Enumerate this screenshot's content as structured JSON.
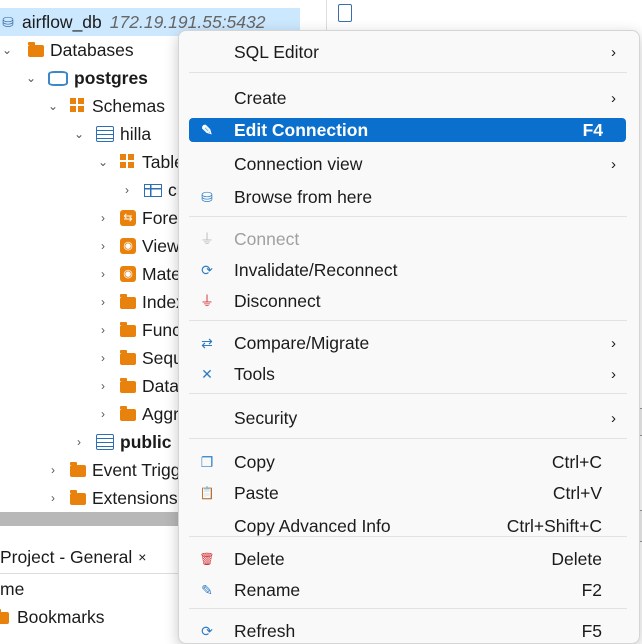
{
  "tree": {
    "connection": {
      "name": "airflow_db",
      "address": "172.19.191.55:5432"
    },
    "rows": [
      {
        "label": "Databases",
        "bold": false
      },
      {
        "label": "postgres",
        "bold": true
      },
      {
        "label": "Schemas",
        "bold": false
      },
      {
        "label": "hilla",
        "bold": false
      },
      {
        "label": "Table",
        "bold": false
      },
      {
        "label": "cr",
        "bold": false
      },
      {
        "label": "Forei",
        "bold": false
      },
      {
        "label": "View",
        "bold": false
      },
      {
        "label": "Mate",
        "bold": false
      },
      {
        "label": "Index",
        "bold": false
      },
      {
        "label": "Func",
        "bold": false
      },
      {
        "label": "Sequ",
        "bold": false
      },
      {
        "label": "Data",
        "bold": false
      },
      {
        "label": "Aggre",
        "bold": false
      },
      {
        "label": "public",
        "bold": true
      },
      {
        "label": "Event Trigg",
        "bold": false
      },
      {
        "label": "Extensions",
        "bold": false
      }
    ]
  },
  "bottom_panel": {
    "tab_label": "Project - General",
    "tab_close": "×",
    "column_header": "me",
    "bookmarks_label": "Bookmarks"
  },
  "context_menu": {
    "items": [
      {
        "label": "SQL Editor",
        "shortcut": "",
        "submenu": true,
        "icon": ""
      },
      {
        "label": "Create",
        "shortcut": "",
        "submenu": true,
        "icon": ""
      },
      {
        "label": "Edit Connection",
        "shortcut": "F4",
        "submenu": false,
        "icon": "pencil-icon",
        "glyph": "✎"
      },
      {
        "label": "Connection view",
        "shortcut": "",
        "submenu": true,
        "icon": ""
      },
      {
        "label": "Browse from here",
        "shortcut": "",
        "submenu": false,
        "icon": "database-browse-icon",
        "glyph": "⛁"
      },
      {
        "label": "Connect",
        "shortcut": "",
        "submenu": false,
        "icon": "plug-icon",
        "glyph": "⏚",
        "disabled": true
      },
      {
        "label": "Invalidate/Reconnect",
        "shortcut": "",
        "submenu": false,
        "icon": "reconnect-icon",
        "glyph": "⟳"
      },
      {
        "label": "Disconnect",
        "shortcut": "",
        "submenu": false,
        "icon": "disconnect-icon",
        "glyph": "⏚"
      },
      {
        "label": "Compare/Migrate",
        "shortcut": "",
        "submenu": true,
        "icon": "compare-icon",
        "glyph": "⇄"
      },
      {
        "label": "Tools",
        "shortcut": "",
        "submenu": true,
        "icon": "tools-icon",
        "glyph": "✕"
      },
      {
        "label": "Security",
        "shortcut": "",
        "submenu": true,
        "icon": ""
      },
      {
        "label": "Copy",
        "shortcut": "Ctrl+C",
        "submenu": false,
        "icon": "copy-icon",
        "glyph": "❐"
      },
      {
        "label": "Paste",
        "shortcut": "Ctrl+V",
        "submenu": false,
        "icon": "paste-icon",
        "glyph": "📋"
      },
      {
        "label": "Copy Advanced Info",
        "shortcut": "Ctrl+Shift+C",
        "submenu": false,
        "icon": ""
      },
      {
        "label": "Delete",
        "shortcut": "Delete",
        "submenu": false,
        "icon": "delete-icon",
        "glyph": "🗑"
      },
      {
        "label": "Rename",
        "shortcut": "F2",
        "submenu": false,
        "icon": "rename-icon",
        "glyph": "✎"
      },
      {
        "label": "Refresh",
        "shortcut": "F5",
        "submenu": false,
        "icon": "refresh-icon",
        "glyph": "⟳"
      }
    ]
  },
  "colors": {
    "accent": "#0a6fcd",
    "folder": "#e9820c",
    "selection": "#cce8ff",
    "delete_icon": "#d13438",
    "disconnect_icon": "#d13438"
  }
}
